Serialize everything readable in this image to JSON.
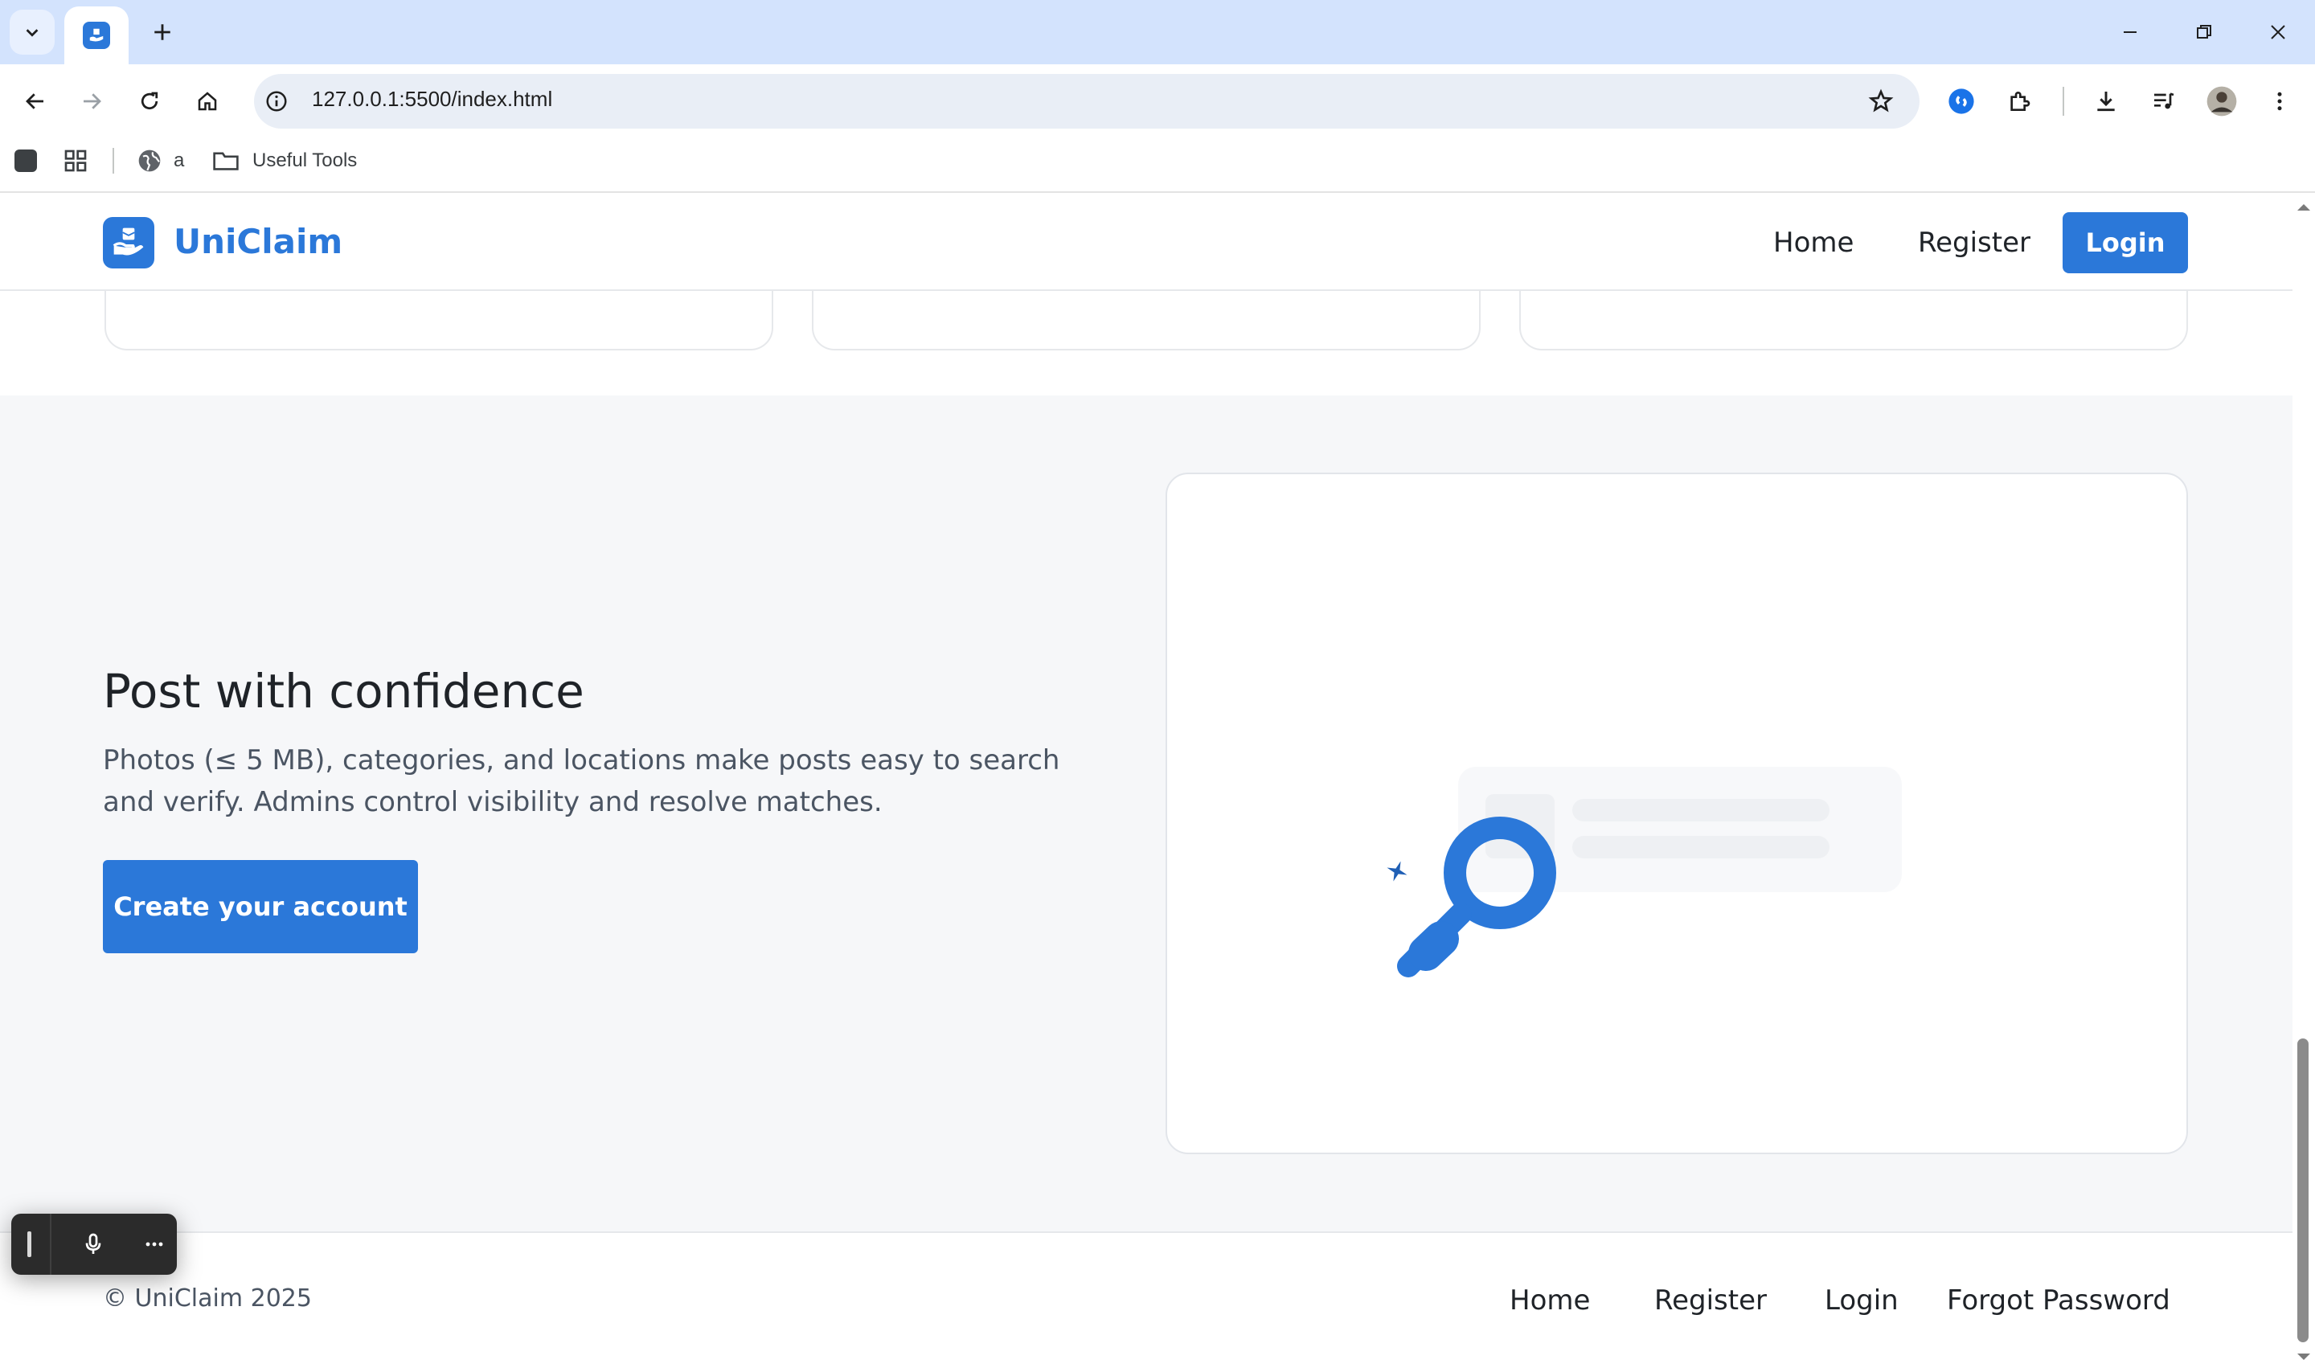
{
  "browser": {
    "url": "127.0.0.1:5500/index.html",
    "bookmarks": [
      {
        "label": "a"
      },
      {
        "label": "Useful Tools"
      }
    ]
  },
  "header": {
    "brand": "UniClaim",
    "nav": [
      "Home",
      "Register"
    ],
    "login_label": "Login"
  },
  "hero": {
    "title": "Post with confidence",
    "text": "Photos (≤ 5 MB), categories, and locations make posts easy to search and verify. Admins control visibility and resolve matches.",
    "cta_label": "Create your account"
  },
  "footer": {
    "copyright": "© UniClaim 2025",
    "links": [
      "Home",
      "Register",
      "Login",
      "Forgot Password"
    ]
  },
  "colors": {
    "accent": "#2b78d9",
    "dark_accent": "#1f5fb5",
    "section_bg": "#f6f7f9"
  },
  "icons": {
    "illustration": "magnifier-search-icon",
    "sparkle": "sparkle-icon"
  }
}
